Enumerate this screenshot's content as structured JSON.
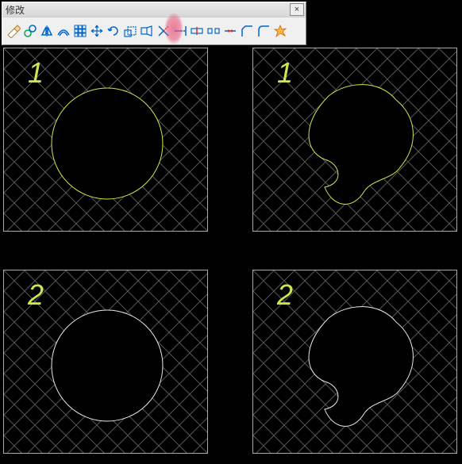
{
  "toolbar": {
    "title": "修改",
    "close_symbol": "×",
    "tools": [
      {
        "name": "erase",
        "title": "Erase"
      },
      {
        "name": "copy",
        "title": "Copy"
      },
      {
        "name": "mirror",
        "title": "Mirror"
      },
      {
        "name": "offset",
        "title": "Offset"
      },
      {
        "name": "array",
        "title": "Array"
      },
      {
        "name": "move",
        "title": "Move"
      },
      {
        "name": "rotate",
        "title": "Rotate"
      },
      {
        "name": "scale",
        "title": "Scale"
      },
      {
        "name": "stretch",
        "title": "Stretch"
      },
      {
        "name": "trim",
        "title": "Trim"
      },
      {
        "name": "extend",
        "title": "Extend"
      },
      {
        "name": "break-point",
        "title": "Break at Point"
      },
      {
        "name": "break",
        "title": "Break"
      },
      {
        "name": "join",
        "title": "Join"
      },
      {
        "name": "chamfer",
        "title": "Chamfer"
      },
      {
        "name": "fillet",
        "title": "Fillet"
      },
      {
        "name": "explode",
        "title": "Explode"
      }
    ]
  },
  "viewports": {
    "top_left": {
      "label": "1"
    },
    "top_right": {
      "label": "1"
    },
    "bottom_left": {
      "label": "2"
    },
    "bottom_right": {
      "label": "2"
    }
  },
  "colors": {
    "geometry_yellow": "#cde84a",
    "geometry_white": "#e8e8e8",
    "hatch": "#555555",
    "highlight": "#e95478"
  }
}
